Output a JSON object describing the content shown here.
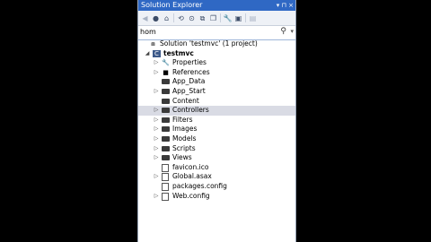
{
  "panel": {
    "title": "Solution Explorer",
    "title_controls": "▾ ⊓ ×",
    "toolbar_icons": [
      "back-icon",
      "forward-icon",
      "home-icon",
      "history-icon",
      "sync-icon",
      "collapse-icon",
      "copy-icon",
      "properties-icon",
      "show-all-icon",
      "preview-icon"
    ],
    "search": {
      "value": "hom",
      "icon": "search-icon"
    }
  },
  "tree": [
    {
      "label": "Solution 'testmvc' (1 project)",
      "indent": 0,
      "twisty": "",
      "icon": "solution"
    },
    {
      "label": "testmvc",
      "indent": 1,
      "twisty": "◢",
      "icon": "project",
      "bold": true
    },
    {
      "label": "Properties",
      "indent": 2,
      "twisty": "▷",
      "icon": "wrench"
    },
    {
      "label": "References",
      "indent": 2,
      "twisty": "▷",
      "icon": "references"
    },
    {
      "label": "App_Data",
      "indent": 2,
      "twisty": "",
      "icon": "folder"
    },
    {
      "label": "App_Start",
      "indent": 2,
      "twisty": "▷",
      "icon": "folder"
    },
    {
      "label": "Content",
      "indent": 2,
      "twisty": "",
      "icon": "folder"
    },
    {
      "label": "Controllers",
      "indent": 2,
      "twisty": "▷",
      "icon": "folder",
      "selected": true
    },
    {
      "label": "Filters",
      "indent": 2,
      "twisty": "▷",
      "icon": "folder"
    },
    {
      "label": "Images",
      "indent": 2,
      "twisty": "▷",
      "icon": "folder"
    },
    {
      "label": "Models",
      "indent": 2,
      "twisty": "▷",
      "icon": "folder"
    },
    {
      "label": "Scripts",
      "indent": 2,
      "twisty": "▷",
      "icon": "folder"
    },
    {
      "label": "Views",
      "indent": 2,
      "twisty": "▷",
      "icon": "folder"
    },
    {
      "label": "favicon.ico",
      "indent": 2,
      "twisty": "",
      "icon": "file"
    },
    {
      "label": "Global.asax",
      "indent": 2,
      "twisty": "▷",
      "icon": "file"
    },
    {
      "label": "packages.config",
      "indent": 2,
      "twisty": "",
      "icon": "file"
    },
    {
      "label": "Web.config",
      "indent": 2,
      "twisty": "▷",
      "icon": "file"
    }
  ],
  "colors": {
    "titlebar": "#2f68c4",
    "selection": "#d9dbe4",
    "background": "#000000"
  }
}
